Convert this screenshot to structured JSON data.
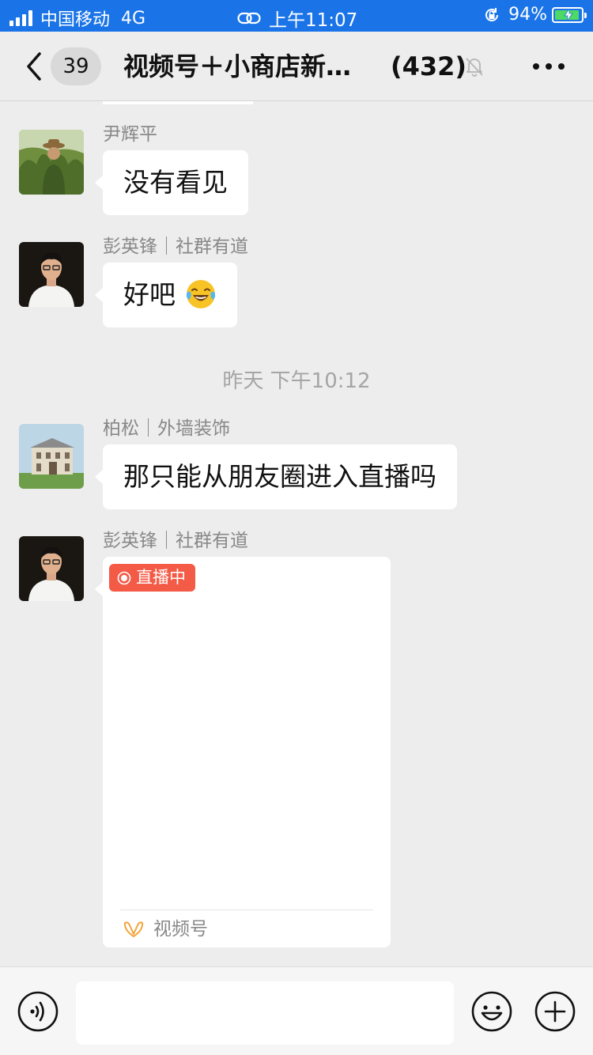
{
  "status_bar": {
    "carrier": "中国移动",
    "network": "4G",
    "time": "上午11:07",
    "battery_percent": "94%",
    "battery_level": 0.94
  },
  "nav": {
    "back_count": "39",
    "title": "视频号＋小商店新…",
    "member_count": "(432)",
    "icons": [
      "chevron-left-icon",
      "muted-bell-icon",
      "more-icon"
    ]
  },
  "messages": [
    {
      "sender": "尹辉平",
      "text": "没有看见"
    },
    {
      "sender": "彭英锋｜社群有道",
      "text": "好吧",
      "emoji": "laugh-cry-emoji-icon"
    },
    {
      "sender": "柏松｜外墙装饰",
      "text": "那只能从朋友圈进入直播吗"
    },
    {
      "sender": "彭英锋｜社群有道",
      "card": {
        "badge": "直播中",
        "source": "视频号"
      }
    }
  ],
  "timestamp": "昨天 下午10:12",
  "input_bar": {
    "placeholder": "",
    "icons": [
      "voice-icon",
      "emoji-icon",
      "plus-icon"
    ]
  },
  "colors": {
    "status_bar": "#1a74e8",
    "background": "#ededed",
    "live_badge": "#f45b47",
    "channels_icon": "#f3a43b"
  }
}
